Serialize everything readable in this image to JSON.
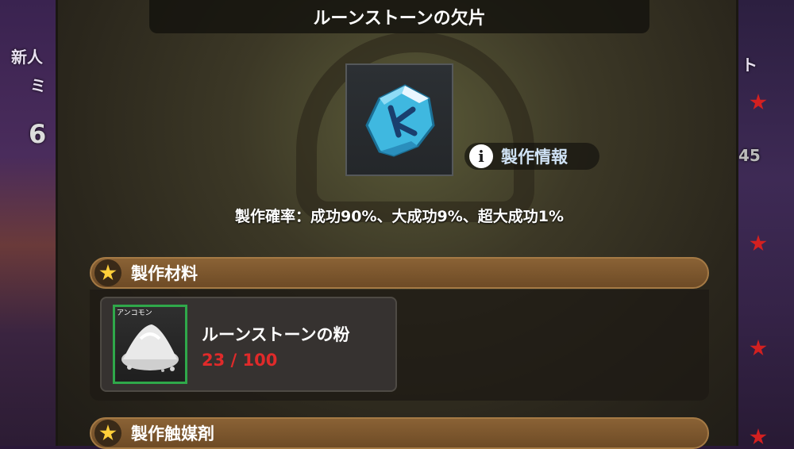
{
  "title": "ルーンストーンの欠片",
  "item": {
    "icon": "rune-stone-shard-icon"
  },
  "craft_info": {
    "label": "製作情報",
    "icon": "info-icon"
  },
  "craft_rate": "製作確率：成功90%、大成功9%、超大成功1%",
  "materials_section": {
    "label": "製作材料"
  },
  "material": {
    "rarity": "アンコモン",
    "name": "ルーンストーンの粉",
    "count": "23 / 100",
    "icon": "rune-stone-powder-icon"
  },
  "catalyst_section": {
    "label": "製作触媒剤"
  },
  "background": {
    "left_text_1": "新人",
    "left_text_2": "ミ",
    "left_text_3": "6",
    "right_text_1": "ト",
    "right_text_2": "45"
  },
  "colors": {
    "accent_gold": "#ffcf3a",
    "section_brown": "#7a5530",
    "count_red": "#e02a2a",
    "rarity_green": "#2fa84a",
    "info_blue": "#cfe2f5"
  }
}
